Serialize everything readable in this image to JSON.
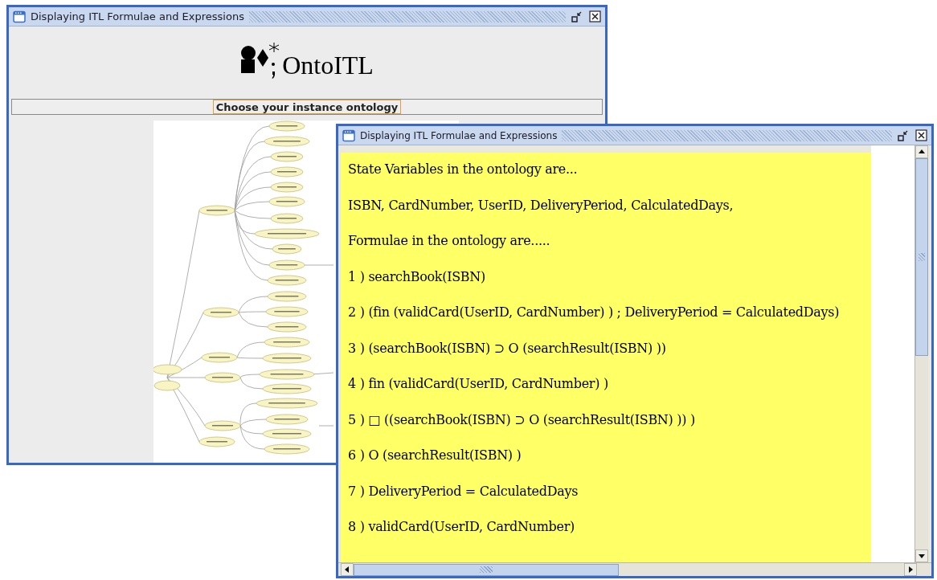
{
  "back_window": {
    "title": "Displaying ITL Formulae and Expressions",
    "logo_text": "OntoITL",
    "choose_button": "Choose your instance ontology"
  },
  "front_window": {
    "title": "Displaying ITL Formulae and Expressions",
    "lines": [
      "State Variables in the ontology are...",
      "ISBN, CardNumber, UserID, DeliveryPeriod, CalculatedDays,",
      "Formulae in the ontology are.....",
      "1 ) searchBook(ISBN)",
      "2 ) (fin (validCard(UserID, CardNumber) ) ; DeliveryPeriod = CalculatedDays)",
      "3 ) (searchBook(ISBN) ⊃ O (searchResult(ISBN) ))",
      "4 ) fin (validCard(UserID, CardNumber) )",
      "5 ) □ ((searchBook(ISBN) ⊃ O (searchResult(ISBN) )) )",
      "6 ) O (searchResult(ISBN) )",
      "7 ) DeliveryPeriod = CalculatedDays",
      "8 ) validCard(UserID, CardNumber)"
    ]
  }
}
